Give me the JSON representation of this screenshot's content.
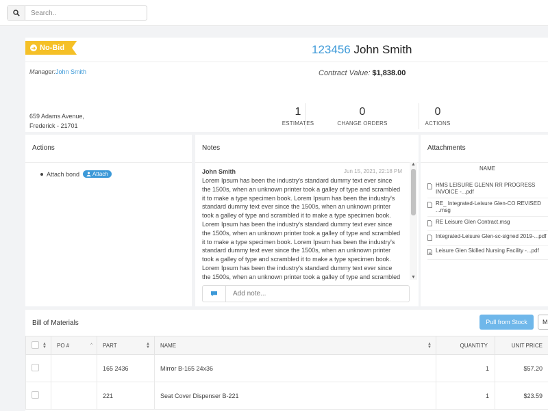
{
  "search": {
    "placeholder": "Search.."
  },
  "header": {
    "status_badge": "No-Bid",
    "title_number": "123456",
    "title_name": "John Smith",
    "manager_label": "Manager:",
    "manager_name": "John Smith",
    "contract_label": "Contract Value:",
    "contract_value": "$1,838.00",
    "address_line1": "659 Adams Avenue,",
    "address_line2": "Frederick - 21701",
    "stats": [
      {
        "value": "1",
        "label": "ESTIMATES"
      },
      {
        "value": "0",
        "label": "CHANGE ORDERS"
      },
      {
        "value": "0",
        "label": "ACTIONS"
      }
    ]
  },
  "actions": {
    "title": "Actions",
    "item_label": "Attach bond",
    "item_button": "Attach"
  },
  "notes": {
    "title": "Notes",
    "author": "John Smith",
    "date": "Jun 15, 2021, 22:18 PM",
    "body": "Lorem Ipsum has been the industry's standard dummy text ever since the 1500s, when an unknown printer took a galley of type and scrambled it to make a type specimen book. Lorem Ipsum has been the industry's standard dummy text ever since the 1500s, when an unknown printer took a galley of type and scrambled it to make a type specimen book. Lorem Ipsum has been the industry's standard dummy text ever since the 1500s, when an unknown printer took a galley of type and scrambled it to make a type specimen book. Lorem Ipsum has been the industry's standard dummy text ever since the 1500s, when an unknown printer took a galley of type and scrambled it to make a type specimen book. Lorem Ipsum has been the industry's standard dummy text ever since the 1500s, when an unknown printer took a galley of type and scrambled it to make a type specimen book. Lorem Ipsum has been the",
    "add_placeholder": "Add note..."
  },
  "attachments": {
    "title": "Attachments",
    "column": "NAME",
    "files": [
      {
        "name": "HMS LEISURE GLENN RR PROGRESS INVOICE -...pdf",
        "icon": "file-icon"
      },
      {
        "name": "RE_ Integrated-Leisure Glen-CO REVISED ...msg",
        "icon": "file-icon"
      },
      {
        "name": "RE Leisure Glen Contract.msg",
        "icon": "file-icon"
      },
      {
        "name": "Integrated-Leisure Glen-sc-signed 2019-...pdf",
        "icon": "file-icon"
      },
      {
        "name": "Leisure Glen Skilled Nursing Facility -...pdf",
        "icon": "pdf-icon"
      }
    ]
  },
  "bom": {
    "title": "Bill of Materials",
    "pull_button": "Pull from Stock",
    "more_button": "M",
    "columns": [
      "PO #",
      "PART",
      "NAME",
      "QUANTITY",
      "UNIT PRICE"
    ],
    "rows": [
      {
        "po": "",
        "part": "165 2436",
        "name": "Mirror B-165 24x36",
        "qty": "1",
        "price": "$57.20"
      },
      {
        "po": "",
        "part": "221",
        "name": "Seat Cover Dispenser B-221",
        "qty": "1",
        "price": "$23.59"
      }
    ]
  },
  "colors": {
    "accent": "#3c99d8",
    "badge": "#f5c027",
    "button": "#6fb7ea"
  }
}
